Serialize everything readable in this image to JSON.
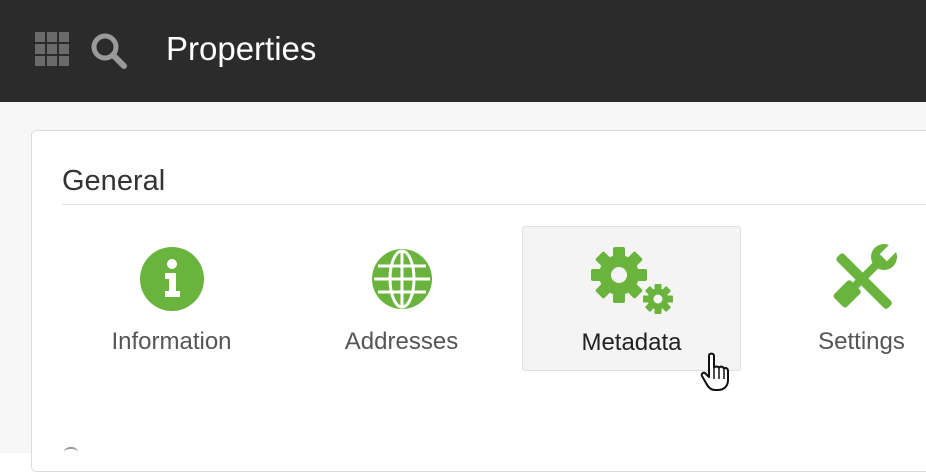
{
  "header": {
    "title": "Properties",
    "apps_icon": "apps-grid-icon",
    "search_icon": "search-icon"
  },
  "section": {
    "title": "General"
  },
  "tiles": [
    {
      "label": "Information",
      "icon": "info-circle-icon",
      "active": false
    },
    {
      "label": "Addresses",
      "icon": "globe-icon",
      "active": false
    },
    {
      "label": "Metadata",
      "icon": "gears-icon",
      "active": true
    },
    {
      "label": "Settings",
      "icon": "wrench-screwdriver-icon",
      "active": false
    }
  ],
  "colors": {
    "accent_green": "#6ab43e",
    "header_bg": "#2b2b2b",
    "active_tile_bg": "#f4f4f4"
  }
}
